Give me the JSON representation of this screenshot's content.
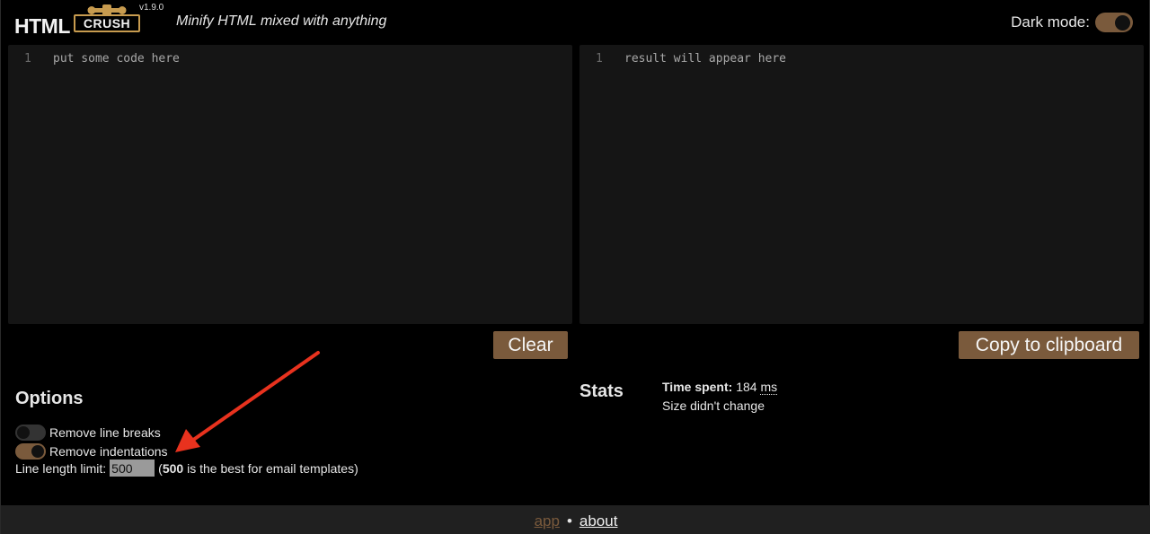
{
  "header": {
    "logo_html": "HTML",
    "logo_crush": "CRUSH",
    "version": "v1.9.0",
    "tagline": "Minify HTML mixed with anything",
    "dark_mode_label": "Dark mode:",
    "dark_mode_on": true
  },
  "input_editor": {
    "line_number": "1",
    "placeholder": "put some code here"
  },
  "output_editor": {
    "line_number": "1",
    "placeholder": "result will appear here"
  },
  "buttons": {
    "clear": "Clear",
    "copy": "Copy to clipboard"
  },
  "options": {
    "title": "Options",
    "remove_line_breaks": {
      "label": "Remove line breaks",
      "on": false
    },
    "remove_indentations": {
      "label": "Remove indentations",
      "on": true
    },
    "line_length_label": "Line length limit:",
    "line_length_value": "500",
    "hint_bold": "500",
    "hint_text": " is the best for email templates)",
    "hint_open": "("
  },
  "stats": {
    "title": "Stats",
    "time_label": "Time spent:",
    "time_value": "184",
    "time_unit": "ms",
    "size_text": "Size didn't change"
  },
  "footer": {
    "app": "app",
    "separator": "•",
    "about": "about"
  },
  "colors": {
    "accent": "#7a5a3c",
    "logo_gold": "#c79b4f",
    "annotation_arrow": "#e8321e"
  },
  "icons": {
    "logo_clamp": "clamp-icon",
    "annotation": "red-arrow-icon"
  }
}
